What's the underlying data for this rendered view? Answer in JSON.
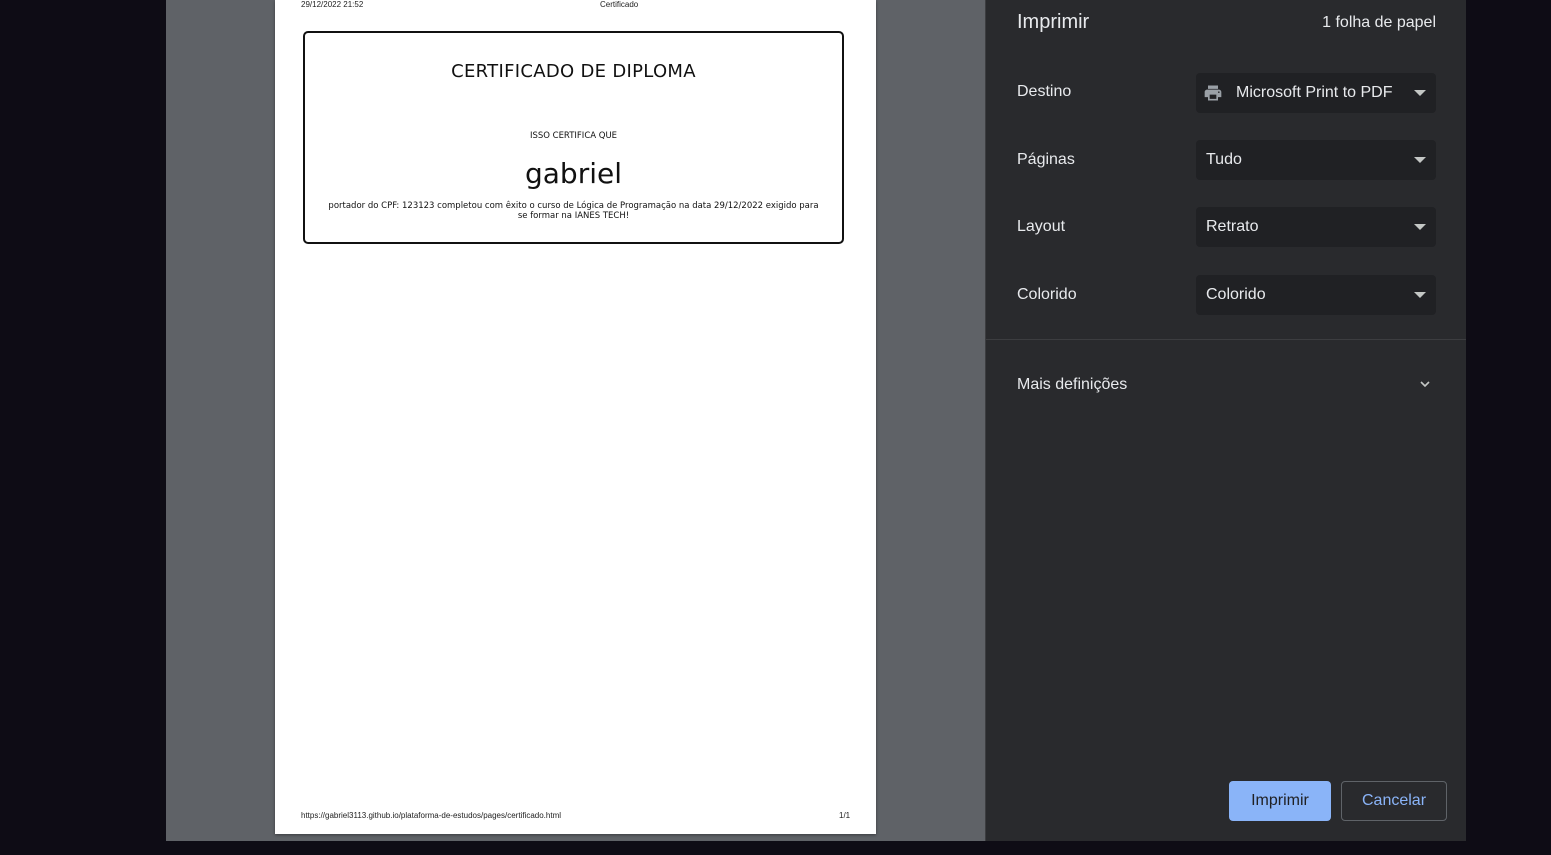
{
  "preview": {
    "header_left": "29/12/2022 21:52",
    "header_center": "Certificado",
    "footer_url": "https://gabriel3113.github.io/plataforma-de-estudos/pages/certificado.html",
    "footer_page": "1/1",
    "certificate": {
      "title": "CERTIFICADO DE DIPLOMA",
      "subtitle": "ISSO CERTIFICA QUE",
      "name": "gabriel",
      "body": "portador do CPF: 123123 completou com êxito o curso de Lógica de Programação na data 29/12/2022 exigido para se formar na IANES TECH!"
    }
  },
  "panel": {
    "title": "Imprimir",
    "sheet_count": "1 folha de papel",
    "rows": [
      {
        "label": "Destino",
        "value": "Microsoft Print to PDF",
        "icon": "printer-icon"
      },
      {
        "label": "Páginas",
        "value": "Tudo"
      },
      {
        "label": "Layout",
        "value": "Retrato"
      },
      {
        "label": "Colorido",
        "value": "Colorido"
      }
    ],
    "more_settings": "Mais definições",
    "print_button": "Imprimir",
    "cancel_button": "Cancelar"
  },
  "colors": {
    "panel_bg": "#292a2d",
    "select_bg": "#202124",
    "accent": "#8ab4f8",
    "preview_bg": "#5f6267"
  }
}
